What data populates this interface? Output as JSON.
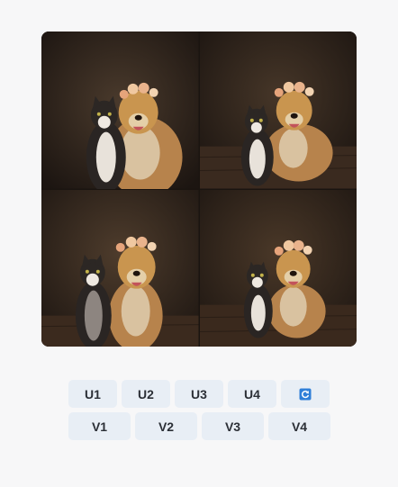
{
  "image_grid": {
    "tiles": [
      {
        "name": "image-1",
        "floor": false
      },
      {
        "name": "image-2",
        "floor": true
      },
      {
        "name": "image-3",
        "floor": true
      },
      {
        "name": "image-4",
        "floor": true
      }
    ]
  },
  "upscale_buttons": [
    "U1",
    "U2",
    "U3",
    "U4"
  ],
  "reroll_button": {
    "icon": "refresh-icon",
    "color": "#2f7fd8"
  },
  "variation_buttons": [
    "V1",
    "V2",
    "V3",
    "V4"
  ],
  "colors": {
    "page_bg": "#f7f7f8",
    "button_bg": "#e8eef5",
    "button_text": "#2b2f36"
  }
}
